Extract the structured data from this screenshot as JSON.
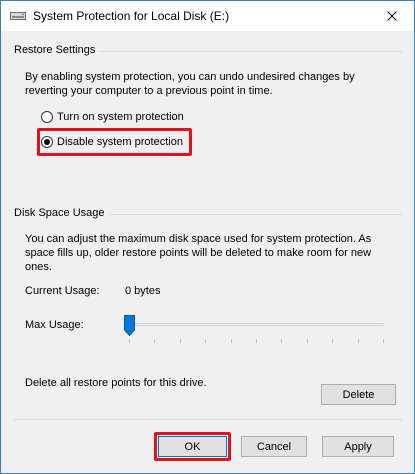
{
  "window": {
    "title": "System Protection for Local Disk (E:)",
    "title_icon": "drive-icon",
    "accent_color": "#0078d7",
    "highlight_color": "#e0141e"
  },
  "restore_settings": {
    "group_label": "Restore Settings",
    "description": "By enabling system protection, you can undo undesired changes by reverting your computer to a previous point in time.",
    "options": [
      {
        "label": "Turn on system protection",
        "selected": false
      },
      {
        "label": "Disable system protection",
        "selected": true
      }
    ]
  },
  "disk_space": {
    "group_label": "Disk Space Usage",
    "description": "You can adjust the maximum disk space used for system protection. As space fills up, older restore points will be deleted to make room for new ones.",
    "current_usage_label": "Current Usage:",
    "current_usage_value": "0 bytes",
    "max_usage_label": "Max Usage:",
    "max_usage_fraction": 0,
    "delete_text": "Delete all restore points for this drive.",
    "delete_label": "Delete"
  },
  "footer": {
    "ok_label": "OK",
    "cancel_label": "Cancel",
    "apply_label": "Apply"
  }
}
